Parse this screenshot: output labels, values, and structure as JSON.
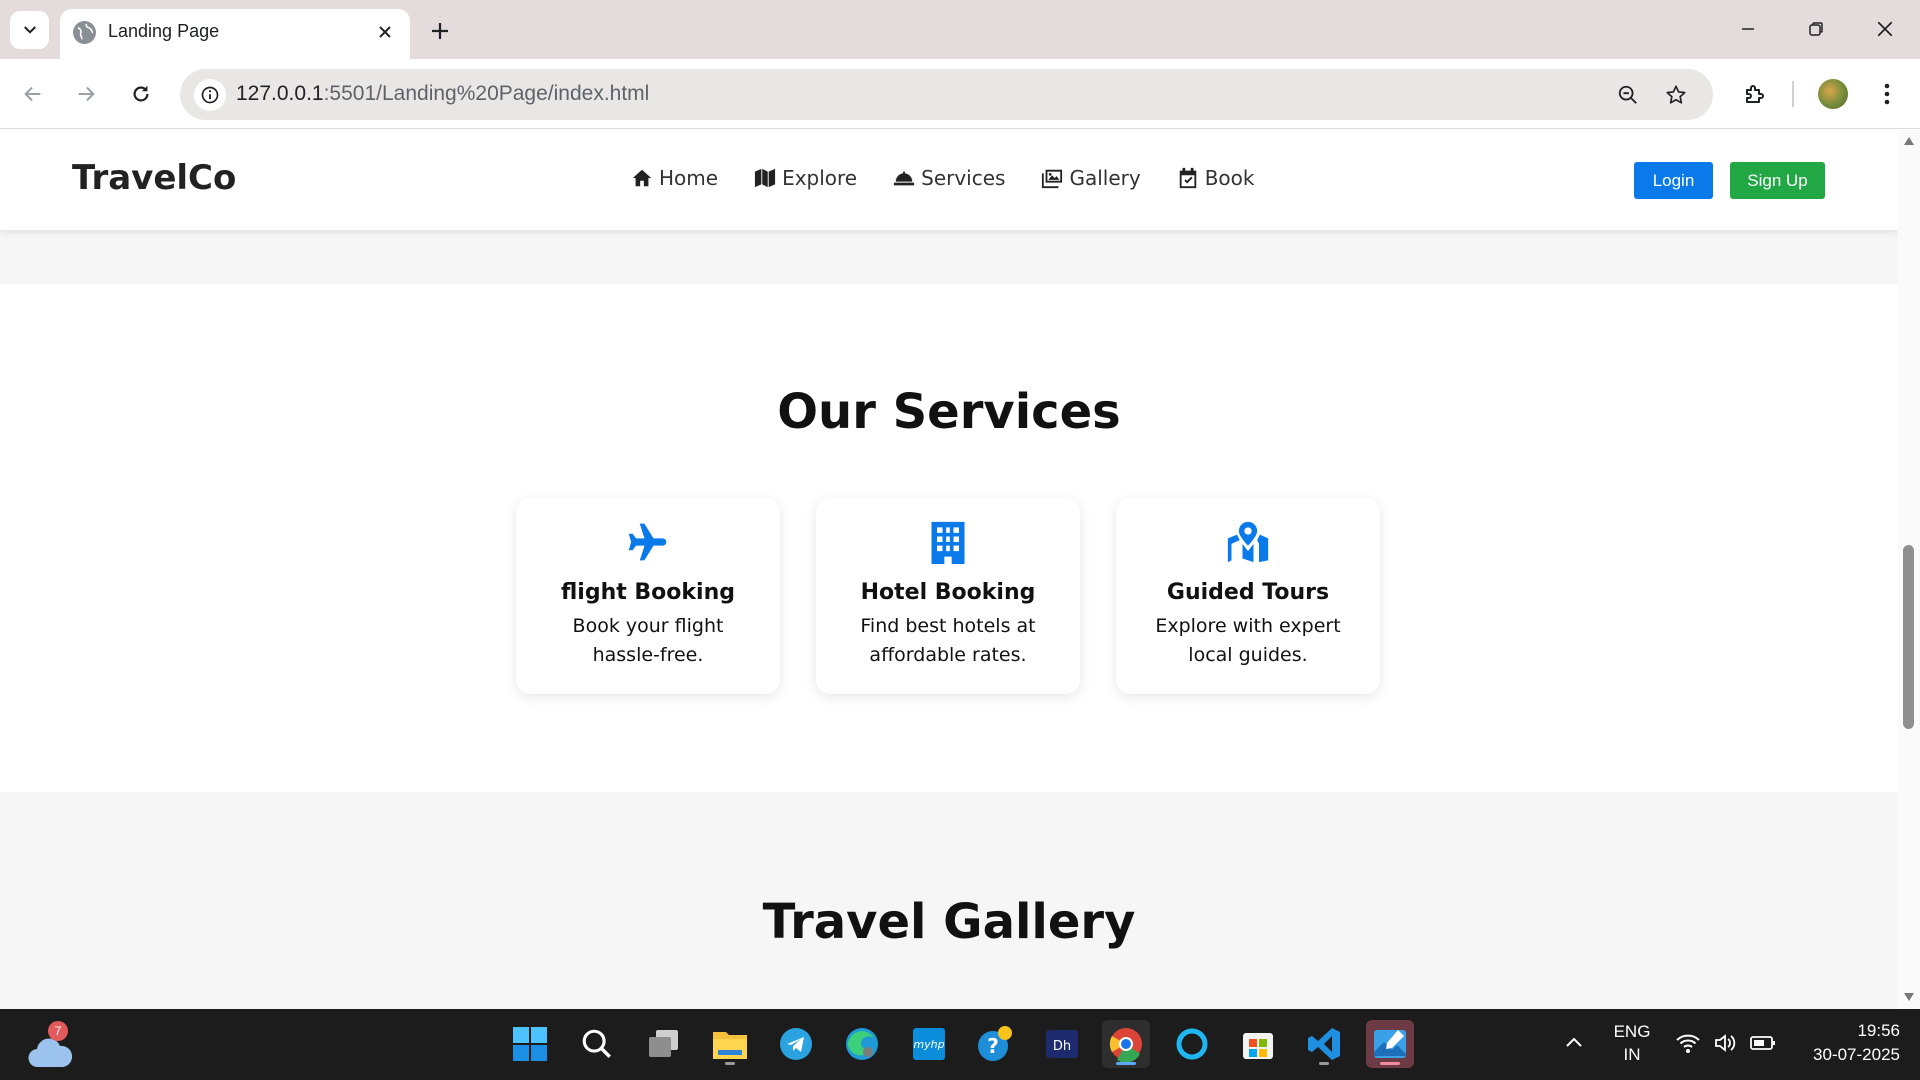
{
  "browser": {
    "tab_title": "Landing Page",
    "url_host": "127.0.0.1",
    "url_rest": ":5501/Landing%20Page/index.html"
  },
  "site": {
    "brand": "TravelCo",
    "nav": [
      {
        "label": "Home",
        "icon": "home-icon"
      },
      {
        "label": "Explore",
        "icon": "map-icon"
      },
      {
        "label": "Services",
        "icon": "concierge-bell-icon"
      },
      {
        "label": "Gallery",
        "icon": "images-icon"
      },
      {
        "label": "Book",
        "icon": "calendar-check-icon"
      }
    ],
    "login_label": "Login",
    "signup_label": "Sign Up",
    "colors": {
      "primary": "#0a7aeb",
      "success": "#22a745"
    }
  },
  "services": {
    "heading": "Our Services",
    "cards": [
      {
        "icon": "plane-icon",
        "title": "flight Booking",
        "desc": "Book your flight hassle-free."
      },
      {
        "icon": "building-icon",
        "title": "Hotel Booking",
        "desc": "Find best hotels at affordable rates."
      },
      {
        "icon": "map-location-icon",
        "title": "Guided Tours",
        "desc": "Explore with expert local guides."
      }
    ]
  },
  "gallery": {
    "heading": "Travel Gallery"
  },
  "taskbar": {
    "weather_badge": "7",
    "lang_1": "ENG",
    "lang_2": "IN",
    "time": "19:56",
    "date": "30-07-2025"
  }
}
